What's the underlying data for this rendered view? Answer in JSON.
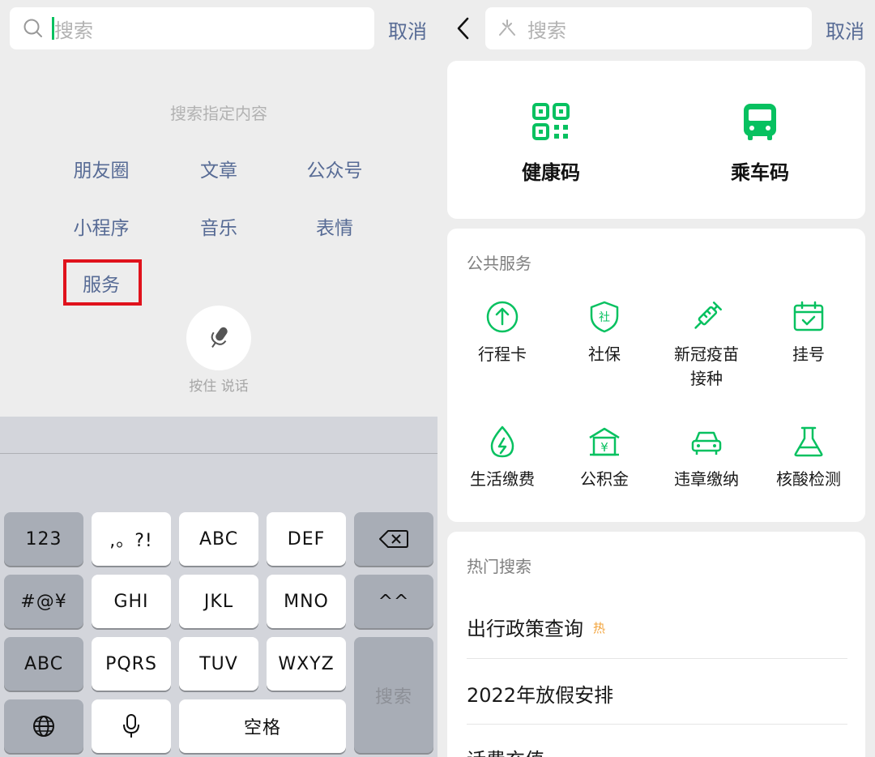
{
  "left": {
    "search": {
      "placeholder": "搜索",
      "cancel": "取消"
    },
    "hint": "搜索指定内容",
    "options": [
      "朋友圈",
      "文章",
      "公众号",
      "小程序",
      "音乐",
      "表情",
      "服务"
    ],
    "voice_hint": "按住 说话",
    "keyboard": {
      "row1": [
        "123",
        ",。?!",
        "ABC",
        "DEF"
      ],
      "row2": [
        "#@¥",
        "GHI",
        "JKL",
        "MNO",
        "^^"
      ],
      "row3": [
        "ABC",
        "PQRS",
        "TUV",
        "WXYZ"
      ],
      "search_key": "搜索",
      "space": "空格"
    }
  },
  "right": {
    "search": {
      "placeholder": "搜索",
      "cancel": "取消"
    },
    "quick": [
      {
        "label": "健康码",
        "icon": "qr-code-icon"
      },
      {
        "label": "乘车码",
        "icon": "bus-icon"
      }
    ],
    "public_services": {
      "title": "公共服务",
      "items": [
        {
          "label": "行程卡",
          "icon": "arrow-up-circle-icon"
        },
        {
          "label": "社保",
          "icon": "shield-icon"
        },
        {
          "label": "新冠疫苗",
          "label2": "接种",
          "icon": "syringe-icon"
        },
        {
          "label": "挂号",
          "icon": "calendar-check-icon"
        },
        {
          "label": "生活缴费",
          "icon": "droplet-bolt-icon"
        },
        {
          "label": "公积金",
          "icon": "house-yen-icon"
        },
        {
          "label": "违章缴纳",
          "icon": "car-icon"
        },
        {
          "label": "核酸检测",
          "icon": "flask-icon"
        }
      ]
    },
    "hot_search": {
      "title": "热门搜索",
      "items": [
        "出行政策查询",
        "2022年放假安排",
        "话费充值"
      ],
      "badge": "热"
    }
  },
  "colors": {
    "accent": "#07c160",
    "link": "#576b95",
    "highlight": "#e0121c"
  }
}
